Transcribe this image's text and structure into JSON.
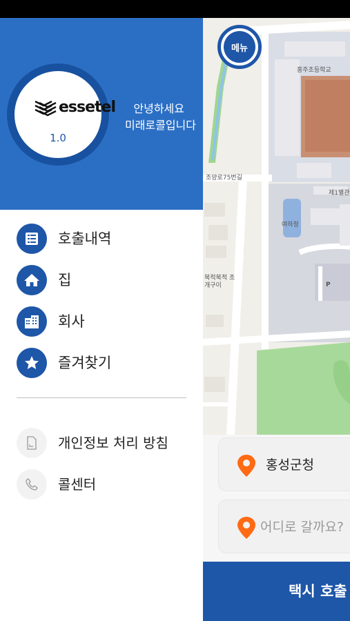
{
  "drawer": {
    "logo_text": "essetel",
    "version": "1.0",
    "greeting_line1": "안녕하세요",
    "greeting_line2": "미래로콜입니다",
    "menu_items": [
      {
        "label": "호출내역",
        "icon": "list-icon"
      },
      {
        "label": "집",
        "icon": "home-icon"
      },
      {
        "label": "회사",
        "icon": "building-icon"
      },
      {
        "label": "즐겨찾기",
        "icon": "star-icon"
      }
    ],
    "sub_items": [
      {
        "label": "개인정보 처리 방침",
        "icon": "document-icon"
      },
      {
        "label": "콜센터",
        "icon": "phone-icon"
      }
    ]
  },
  "map": {
    "menu_button_label": "메뉴",
    "labels": {
      "school": "홍주초등학교",
      "road": "조양로75번길",
      "building": "제1별관",
      "pond": "여하정",
      "restaurant": "북적북적 조개구이",
      "parking": "P"
    }
  },
  "origin": {
    "value": "홍성군청"
  },
  "destination": {
    "placeholder": "어디로 갈까요?"
  },
  "call_button": {
    "label": "택시 호출"
  },
  "colors": {
    "primary": "#1e56a8",
    "header": "#2b6fc5",
    "pin": "#ff6a13"
  }
}
